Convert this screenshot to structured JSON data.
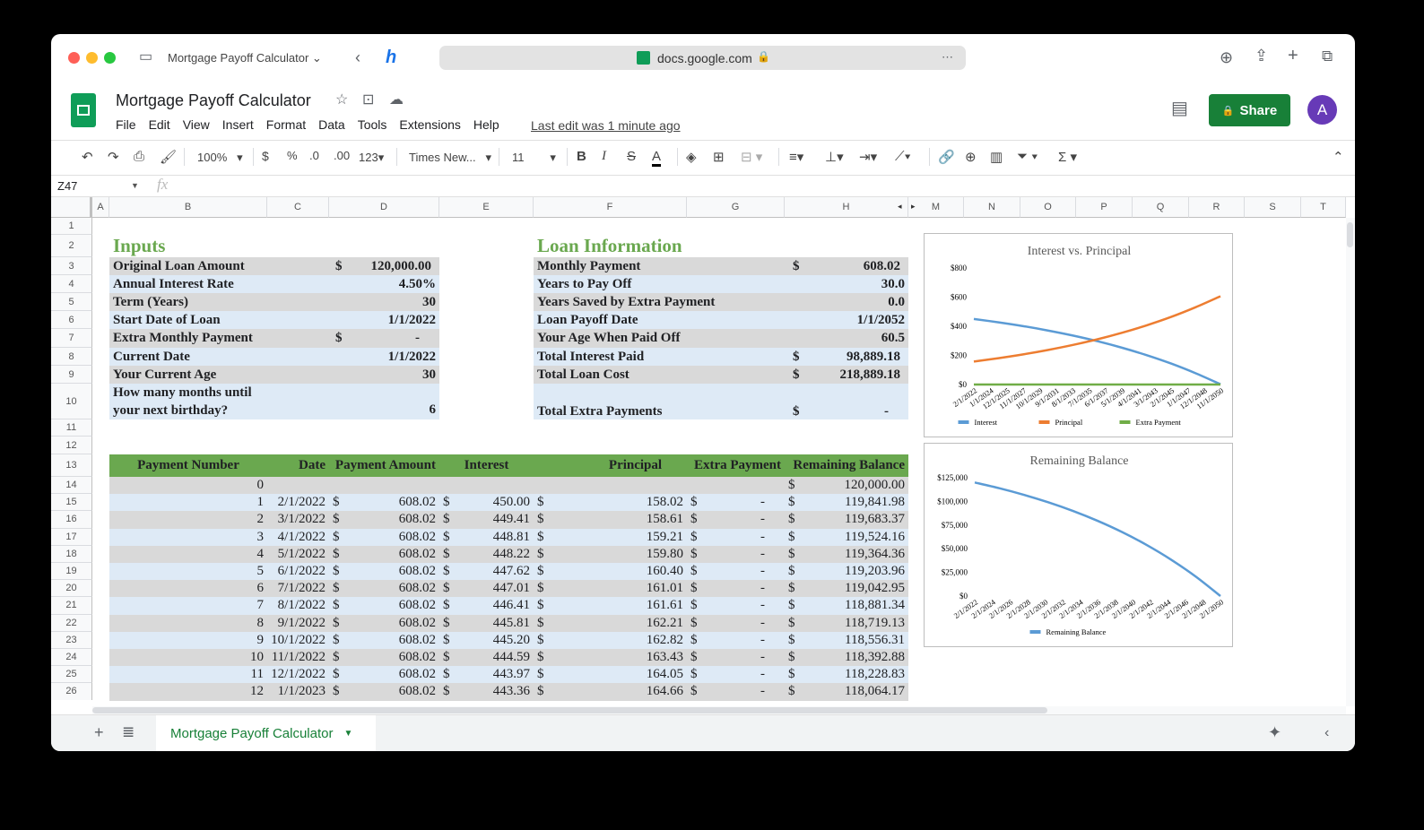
{
  "browser": {
    "tab_title": "Mortgage Payoff Calculator",
    "url": "docs.google.com"
  },
  "doc": {
    "title": "Mortgage Payoff Calculator",
    "menus": [
      "File",
      "Edit",
      "View",
      "Insert",
      "Format",
      "Data",
      "Tools",
      "Extensions",
      "Help"
    ],
    "last_edit": "Last edit was 1 minute ago",
    "share_label": "Share",
    "avatar_letter": "A"
  },
  "toolbar": {
    "zoom": "100%",
    "currency": "$",
    "percent": "%",
    "dec_less": ".0",
    "dec_more": ".00",
    "format_more": "123",
    "font": "Times New...",
    "font_size": "11"
  },
  "formula_bar": {
    "name_box": "Z47",
    "fx": "fx",
    "value": ""
  },
  "columns": [
    "A",
    "B",
    "C",
    "D",
    "E",
    "F",
    "G",
    "H",
    "M",
    "N",
    "O",
    "P",
    "Q",
    "R",
    "S",
    "T"
  ],
  "row_numbers": [
    "1",
    "2",
    "3",
    "4",
    "5",
    "6",
    "7",
    "8",
    "9",
    "10",
    "11",
    "12",
    "13",
    "14",
    "15",
    "16",
    "17",
    "18",
    "19",
    "20",
    "21",
    "22",
    "23",
    "24",
    "25",
    "26"
  ],
  "currency_symbol": "$",
  "inputs": {
    "title": "Inputs",
    "items": [
      {
        "label": "Original Loan Amount",
        "prefix": "$",
        "value": "120,000.00"
      },
      {
        "label": "Annual Interest Rate",
        "prefix": "",
        "value": "4.50%"
      },
      {
        "label": "Term (Years)",
        "prefix": "",
        "value": "30"
      },
      {
        "label": "Start Date of Loan",
        "prefix": "",
        "value": "1/1/2022"
      },
      {
        "label": "Extra Monthly Payment",
        "prefix": "$",
        "value": "-"
      },
      {
        "label": "Current Date",
        "prefix": "",
        "value": "1/1/2022"
      },
      {
        "label": "Your Current Age",
        "prefix": "",
        "value": "30"
      },
      {
        "label": "How many months until\nyour next birthday?",
        "prefix": "",
        "value": "6"
      }
    ]
  },
  "loan_info": {
    "title": "Loan Information",
    "items": [
      {
        "label": "Monthly Payment",
        "prefix": "$",
        "value": "608.02"
      },
      {
        "label": "Years to Pay Off",
        "prefix": "",
        "value": "30.0"
      },
      {
        "label": "Years Saved by Extra Payment",
        "prefix": "",
        "value": "0.0"
      },
      {
        "label": "Loan Payoff Date",
        "prefix": "",
        "value": "1/1/2052"
      },
      {
        "label": "Your Age When Paid Off",
        "prefix": "",
        "value": "60.5"
      },
      {
        "label": "Total Interest Paid",
        "prefix": "$",
        "value": "98,889.18"
      },
      {
        "label": "Total Loan Cost",
        "prefix": "$",
        "value": "218,889.18"
      },
      {
        "label": "Total Extra Payments",
        "prefix": "$",
        "value": "-"
      }
    ]
  },
  "schedule": {
    "headers": [
      "Payment Number",
      "Date",
      "Payment Amount",
      "Interest",
      "Principal",
      "Extra Payment",
      "Remaining Balance"
    ],
    "rows": [
      {
        "n": "0",
        "date": "",
        "payment": "",
        "interest": "",
        "principal": "",
        "extra": "",
        "balance": "120,000.00"
      },
      {
        "n": "1",
        "date": "2/1/2022",
        "payment": "608.02",
        "interest": "450.00",
        "principal": "158.02",
        "extra": "-",
        "balance": "119,841.98"
      },
      {
        "n": "2",
        "date": "3/1/2022",
        "payment": "608.02",
        "interest": "449.41",
        "principal": "158.61",
        "extra": "-",
        "balance": "119,683.37"
      },
      {
        "n": "3",
        "date": "4/1/2022",
        "payment": "608.02",
        "interest": "448.81",
        "principal": "159.21",
        "extra": "-",
        "balance": "119,524.16"
      },
      {
        "n": "4",
        "date": "5/1/2022",
        "payment": "608.02",
        "interest": "448.22",
        "principal": "159.80",
        "extra": "-",
        "balance": "119,364.36"
      },
      {
        "n": "5",
        "date": "6/1/2022",
        "payment": "608.02",
        "interest": "447.62",
        "principal": "160.40",
        "extra": "-",
        "balance": "119,203.96"
      },
      {
        "n": "6",
        "date": "7/1/2022",
        "payment": "608.02",
        "interest": "447.01",
        "principal": "161.01",
        "extra": "-",
        "balance": "119,042.95"
      },
      {
        "n": "7",
        "date": "8/1/2022",
        "payment": "608.02",
        "interest": "446.41",
        "principal": "161.61",
        "extra": "-",
        "balance": "118,881.34"
      },
      {
        "n": "8",
        "date": "9/1/2022",
        "payment": "608.02",
        "interest": "445.81",
        "principal": "162.21",
        "extra": "-",
        "balance": "118,719.13"
      },
      {
        "n": "9",
        "date": "10/1/2022",
        "payment": "608.02",
        "interest": "445.20",
        "principal": "162.82",
        "extra": "-",
        "balance": "118,556.31"
      },
      {
        "n": "10",
        "date": "11/1/2022",
        "payment": "608.02",
        "interest": "444.59",
        "principal": "163.43",
        "extra": "-",
        "balance": "118,392.88"
      },
      {
        "n": "11",
        "date": "12/1/2022",
        "payment": "608.02",
        "interest": "443.97",
        "principal": "164.05",
        "extra": "-",
        "balance": "118,228.83"
      },
      {
        "n": "12",
        "date": "1/1/2023",
        "payment": "608.02",
        "interest": "443.36",
        "principal": "164.66",
        "extra": "-",
        "balance": "118,064.17"
      }
    ]
  },
  "sheet_tab": "Mortgage Payoff Calculator",
  "colors": {
    "green": "#6aa84f",
    "gray": "#d9d9d9",
    "blue": "#deeaf6",
    "interest": "#5b9bd5",
    "principal": "#ed7d31",
    "extra": "#70ad47"
  },
  "chart_data": [
    {
      "type": "line",
      "title": "Interest vs. Principal",
      "ylim": [
        0,
        800
      ],
      "yticks": [
        "$0",
        "$200",
        "$400",
        "$600",
        "$800"
      ],
      "xtick_labels": [
        "2/1/2022",
        "1/1/2024",
        "12/1/2025",
        "11/1/2027",
        "10/1/2029",
        "9/1/2031",
        "8/1/2033",
        "7/1/2035",
        "6/1/2037",
        "5/1/2039",
        "4/1/2041",
        "3/1/2043",
        "2/1/2045",
        "1/1/2047",
        "12/1/2048",
        "11/1/2050"
      ],
      "x_years": [
        0,
        3,
        6,
        9,
        12,
        15,
        18,
        21,
        24,
        27,
        30
      ],
      "series": [
        {
          "name": "Interest",
          "values": [
            450,
            427,
            401,
            371,
            337,
            298,
            253,
            202,
            144,
            77,
            2
          ]
        },
        {
          "name": "Principal",
          "values": [
            158,
            181,
            207,
            237,
            271,
            310,
            355,
            406,
            464,
            531,
            606
          ]
        },
        {
          "name": "Extra Payment",
          "values": [
            0,
            0,
            0,
            0,
            0,
            0,
            0,
            0,
            0,
            0,
            0
          ]
        }
      ],
      "legend": "bottom"
    },
    {
      "type": "line",
      "title": "Remaining Balance",
      "ylim": [
        0,
        125000
      ],
      "yticks": [
        "$0",
        "$25,000",
        "$50,000",
        "$75,000",
        "$100,000",
        "$125,000"
      ],
      "xtick_labels": [
        "2/1/2022",
        "2/1/2024",
        "2/1/2026",
        "2/1/2028",
        "2/1/2030",
        "2/1/2032",
        "2/1/2034",
        "2/1/2036",
        "2/1/2038",
        "2/1/2040",
        "2/1/2042",
        "2/1/2044",
        "2/1/2046",
        "2/1/2048",
        "2/1/2050"
      ],
      "x_years": [
        0,
        3,
        6,
        9,
        12,
        15,
        18,
        21,
        24,
        27,
        30
      ],
      "series": [
        {
          "name": "Remaining Balance",
          "values": [
            120000,
            113924,
            106967,
            99011,
            89905,
            79484,
            67567,
            53927,
            38323,
            20466,
            0
          ]
        }
      ],
      "legend": "bottom"
    }
  ]
}
